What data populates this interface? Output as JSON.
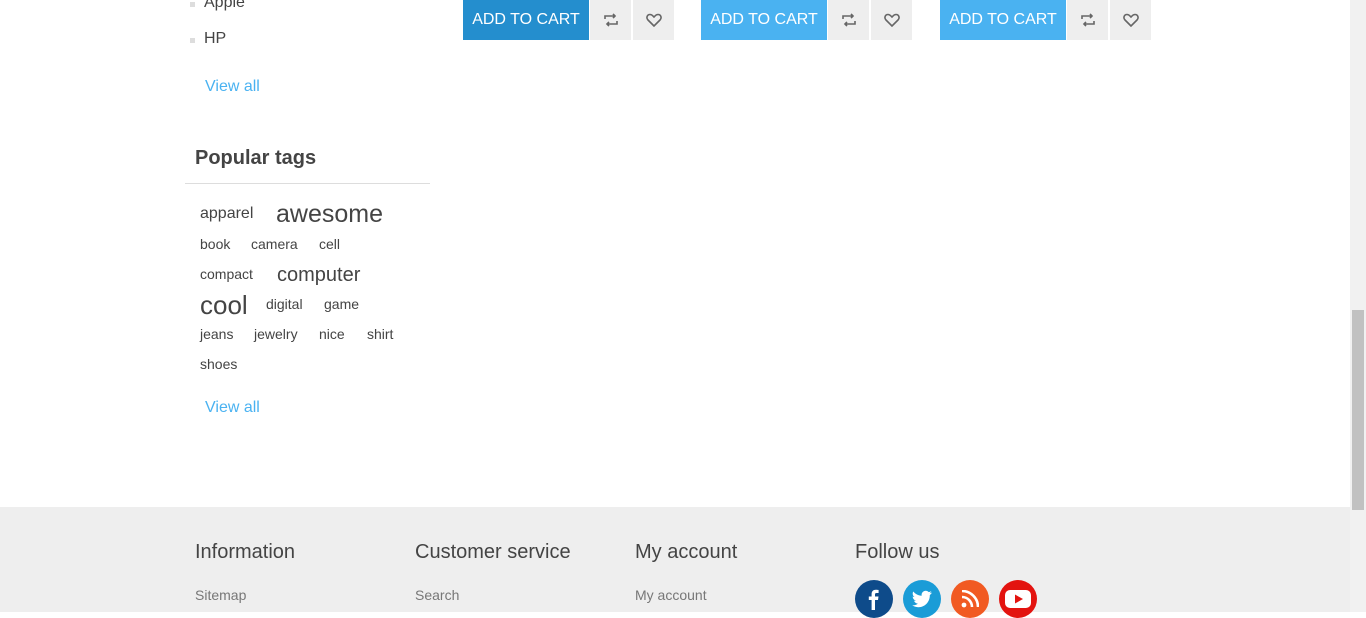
{
  "sidebar": {
    "manufacturers": [
      {
        "label": "Apple"
      },
      {
        "label": "HP"
      }
    ],
    "manufacturers_view_all": "View all",
    "popular_tags_title": "Popular tags",
    "tags": [
      {
        "label": "apparel"
      },
      {
        "label": "awesome"
      },
      {
        "label": "book"
      },
      {
        "label": "camera"
      },
      {
        "label": "cell"
      },
      {
        "label": "compact"
      },
      {
        "label": "computer"
      },
      {
        "label": "cool"
      },
      {
        "label": "digital"
      },
      {
        "label": "game"
      },
      {
        "label": "jeans"
      },
      {
        "label": "jewelry"
      },
      {
        "label": "nice"
      },
      {
        "label": "shirt"
      },
      {
        "label": "shoes"
      }
    ],
    "tags_view_all": "View all"
  },
  "products": [
    {
      "add_to_cart": "ADD TO CART",
      "compare_icon": "compare-icon",
      "wishlist_icon": "heart-icon"
    },
    {
      "add_to_cart": "ADD TO CART",
      "compare_icon": "compare-icon",
      "wishlist_icon": "heart-icon"
    },
    {
      "add_to_cart": "ADD TO CART",
      "compare_icon": "compare-icon",
      "wishlist_icon": "heart-icon"
    }
  ],
  "footer": {
    "columns": [
      {
        "title": "Information",
        "first_link": "Sitemap"
      },
      {
        "title": "Customer service",
        "first_link": "Search"
      },
      {
        "title": "My account",
        "first_link": "My account"
      },
      {
        "title": "Follow us"
      }
    ],
    "social": [
      {
        "icon": "facebook-icon",
        "color": "#0e4b8a"
      },
      {
        "icon": "twitter-icon",
        "color": "#1a9cd7"
      },
      {
        "icon": "rss-icon",
        "color": "#f15a22"
      },
      {
        "icon": "youtube-icon",
        "color": "#e3130f"
      }
    ]
  },
  "colors": {
    "accent": "#4ab2f1",
    "accent_active": "#248ece",
    "footer_bg": "#eeeeee",
    "text": "#444444"
  }
}
